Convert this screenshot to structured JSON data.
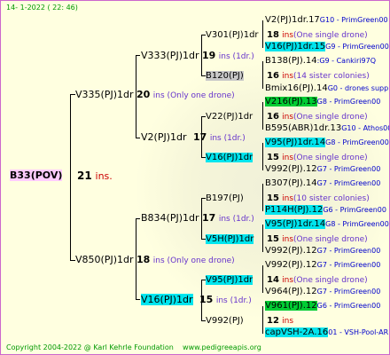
{
  "header": {
    "text": "14-  1-2022  (  22:  46)"
  },
  "footer": {
    "copyright": "Copyright 2004-2022 @ Karl Kehrle Foundation",
    "url": "www.pedigreeapis.org"
  },
  "root": {
    "name": "B33(POV)",
    "count": "21",
    "unit": "ins."
  },
  "g1": [
    {
      "name": "V335(PJ)1dr",
      "count": "20",
      "note": "ins  (Only one drone)"
    },
    {
      "name": "V850(PJ)1dr",
      "count": "18",
      "note": "ins  (Only one drone)"
    }
  ],
  "g2": [
    {
      "name": "V333(PJ)1dr",
      "count": "19",
      "note": "ins  (1dr.)"
    },
    {
      "name": "V2(PJ)1dr",
      "count": "17",
      "note": "ins  (1dr.)"
    },
    {
      "name": "B834(PJ)1dr",
      "count": "17",
      "note": "ins  (1dr.)"
    },
    {
      "name": "V16(PJ)1dr",
      "count": "15",
      "note": "ins  (1dr.)"
    }
  ],
  "g3": [
    {
      "name": "V301(PJ)1dr",
      "count": "18",
      "note": "ins",
      "sub": "(One single drone)"
    },
    {
      "name": "B120(PJ)",
      "count": "16",
      "note": "ins",
      "sub": "(14 sister colonies)"
    },
    {
      "name": "V22(PJ)1dr",
      "count": "16",
      "note": "ins",
      "sub": "(One single drone)"
    },
    {
      "name": "V16(PJ)1dr",
      "count": "15",
      "note": "ins",
      "sub": "(One single drone)"
    },
    {
      "name": "B197(PJ)",
      "count": "15",
      "note": "ins",
      "sub": "(10 sister colonies)"
    },
    {
      "name": "V5H(PJ)1dr",
      "count": "15",
      "note": "ins",
      "sub": "(One single drone)"
    },
    {
      "name": "V95(PJ)1dr",
      "count": "14",
      "note": "ins",
      "sub": "(One single drone)"
    },
    {
      "name": "V992(PJ)",
      "count": "12",
      "note": "ins",
      "sub": ""
    }
  ],
  "g4": [
    {
      "name": "V2(PJ)1dr.17",
      "src": "G10 - PrimGreen00"
    },
    {
      "name": "V16(PJ)1dr.15",
      "src": "G9 - PrimGreen00"
    },
    {
      "name": "B138(PJ).14",
      "src": ":G9 - Cankiri97Q"
    },
    {
      "name": "Bmix16(PJ).14",
      "src": "G0 - drones supp"
    },
    {
      "name": "V216(PJ).13",
      "src": "G8 - PrimGreen00"
    },
    {
      "name": "B595(ABR)1dr.13",
      "src": "G10 - Athos00R"
    },
    {
      "name": "V95(PJ)1dr.14",
      "src": "G8 - PrimGreen00"
    },
    {
      "name": "V992(PJ).12",
      "src": "G7 - PrimGreen00"
    },
    {
      "name": "B307(PJ).14",
      "src": "G7 - PrimGreen00"
    },
    {
      "name": "P114H(PJ).12",
      "src": "G6 - PrimGreen00"
    },
    {
      "name": "V95(PJ)1dr.14",
      "src": "G8 - PrimGreen00"
    },
    {
      "name": "V992(PJ).12",
      "src": "G7 - PrimGreen00"
    },
    {
      "name": "V992(PJ).12",
      "src": "G7 - PrimGreen00"
    },
    {
      "name": "V964(PJ).12",
      "src": "G7 - PrimGreen00"
    },
    {
      "name": "V961(PJ).12",
      "src": "G6 - PrimGreen00"
    },
    {
      "name": "capVSH-2A.16",
      "src": "01 - VSH-Pool-AR"
    }
  ]
}
